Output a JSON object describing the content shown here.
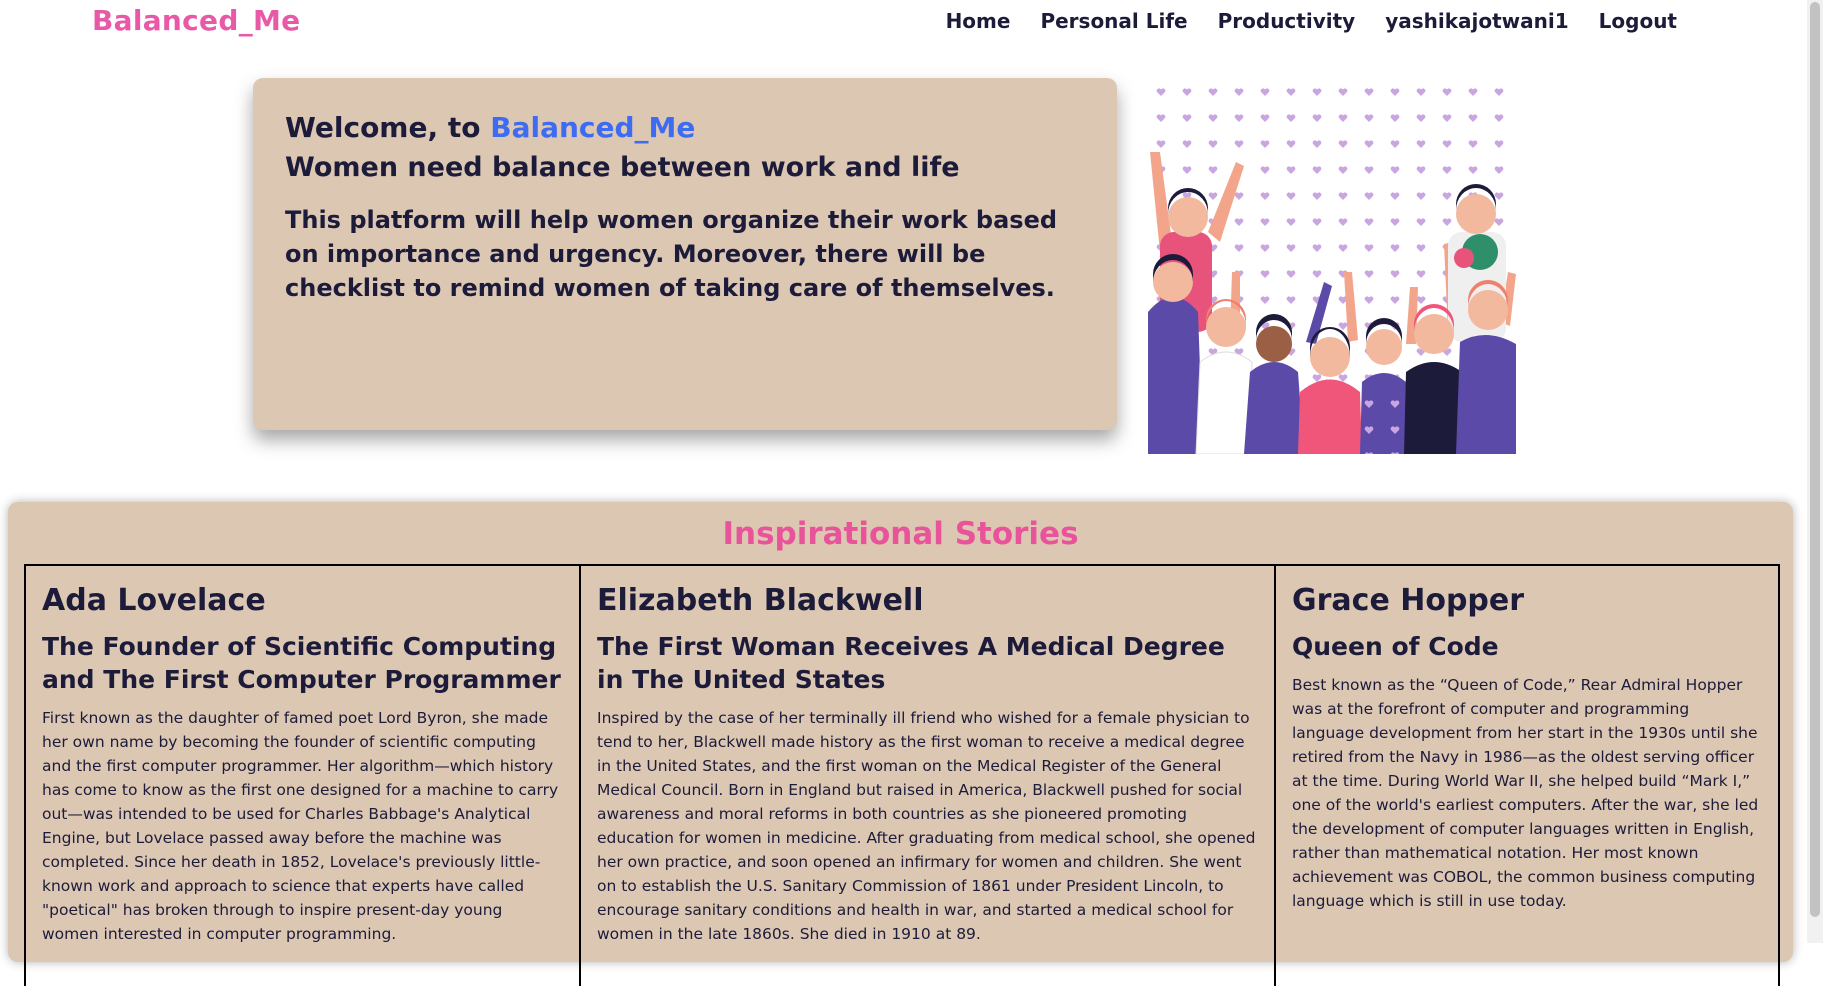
{
  "nav": {
    "brand": "Balanced_Me",
    "links": [
      "Home",
      "Personal Life",
      "Productivity",
      "yashikajotwani1",
      "Logout"
    ]
  },
  "hero": {
    "welcome_prefix": "Welcome, to ",
    "welcome_brand": "Balanced_Me",
    "tagline": "Women need balance between work and life",
    "intro": "This platform will help women organize their work based on importance and urgency. Moreover, there will be checklist to remind women of taking care of themselves."
  },
  "stories": {
    "title": "Inspirational Stories",
    "items": [
      {
        "name": "Ada Lovelace",
        "subtitle": "The Founder of Scientific Computing and The First Computer Programmer",
        "body": "First known as the daughter of famed poet Lord Byron, she made her own name by becoming the founder of scientific computing and the first computer programmer. Her algorithm—which history has come to know as the first one designed for a machine to carry out—was intended to be used for Charles Babbage's Analytical Engine, but Lovelace passed away before the machine was completed. Since her death in 1852, Lovelace's previously little-known work and approach to science that experts have called \"poetical\" has broken through to inspire present-day young women interested in computer programming."
      },
      {
        "name": "Elizabeth Blackwell",
        "subtitle": "The First Woman Receives A Medical Degree in The United States",
        "body": "Inspired by the case of her terminally ill friend who wished for a female physician to tend to her, Blackwell made history as the first woman to receive a medical degree in the United States, and the first woman on the Medical Register of the General Medical Council. Born in England but raised in America, Blackwell pushed for social awareness and moral reforms in both countries as she pioneered promoting education for women in medicine. After graduating from medical school, she opened her own practice, and soon opened an infirmary for women and children. She went on to establish the U.S. Sanitary Commission of 1861 under President Lincoln, to encourage sanitary conditions and health in war, and started a medical school for women in the late 1860s. She died in 1910 at 89."
      },
      {
        "name": "Grace Hopper",
        "subtitle": "Queen of Code",
        "body": "Best known as the “Queen of Code,” Rear Admiral Hopper was at the forefront of computer and programming language development from her start in the 1930s until she retired from the Navy in 1986—as the oldest serving officer at the time. During World War II, she helped build “Mark I,” one of the world's earliest computers. After the war, she led the development of computer languages written in English, rather than mathematical notation. Her most known achievement was COBOL, the common business computing language which is still in use today."
      }
    ]
  }
}
